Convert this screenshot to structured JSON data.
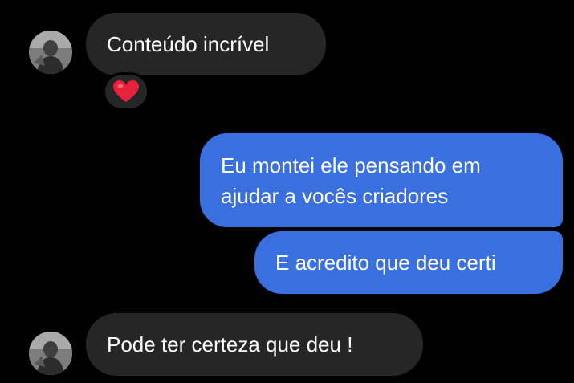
{
  "conversation": {
    "messages": [
      {
        "direction": "incoming",
        "text": "Conteúdo incrível",
        "reaction": "heart-icon"
      },
      {
        "direction": "outgoing",
        "lines": [
          "Eu montei ele pensando em",
          "ajudar a vocês criadores"
        ]
      },
      {
        "direction": "outgoing",
        "text": "E acredito que deu certi"
      },
      {
        "direction": "incoming",
        "text": "Pode ter certeza que deu !"
      }
    ]
  },
  "colors": {
    "background": "#000000",
    "incoming_bubble": "#262626",
    "outgoing_bubble": "#3a6fe0",
    "text": "#ffffff",
    "reaction_heart": "#e8223a"
  }
}
